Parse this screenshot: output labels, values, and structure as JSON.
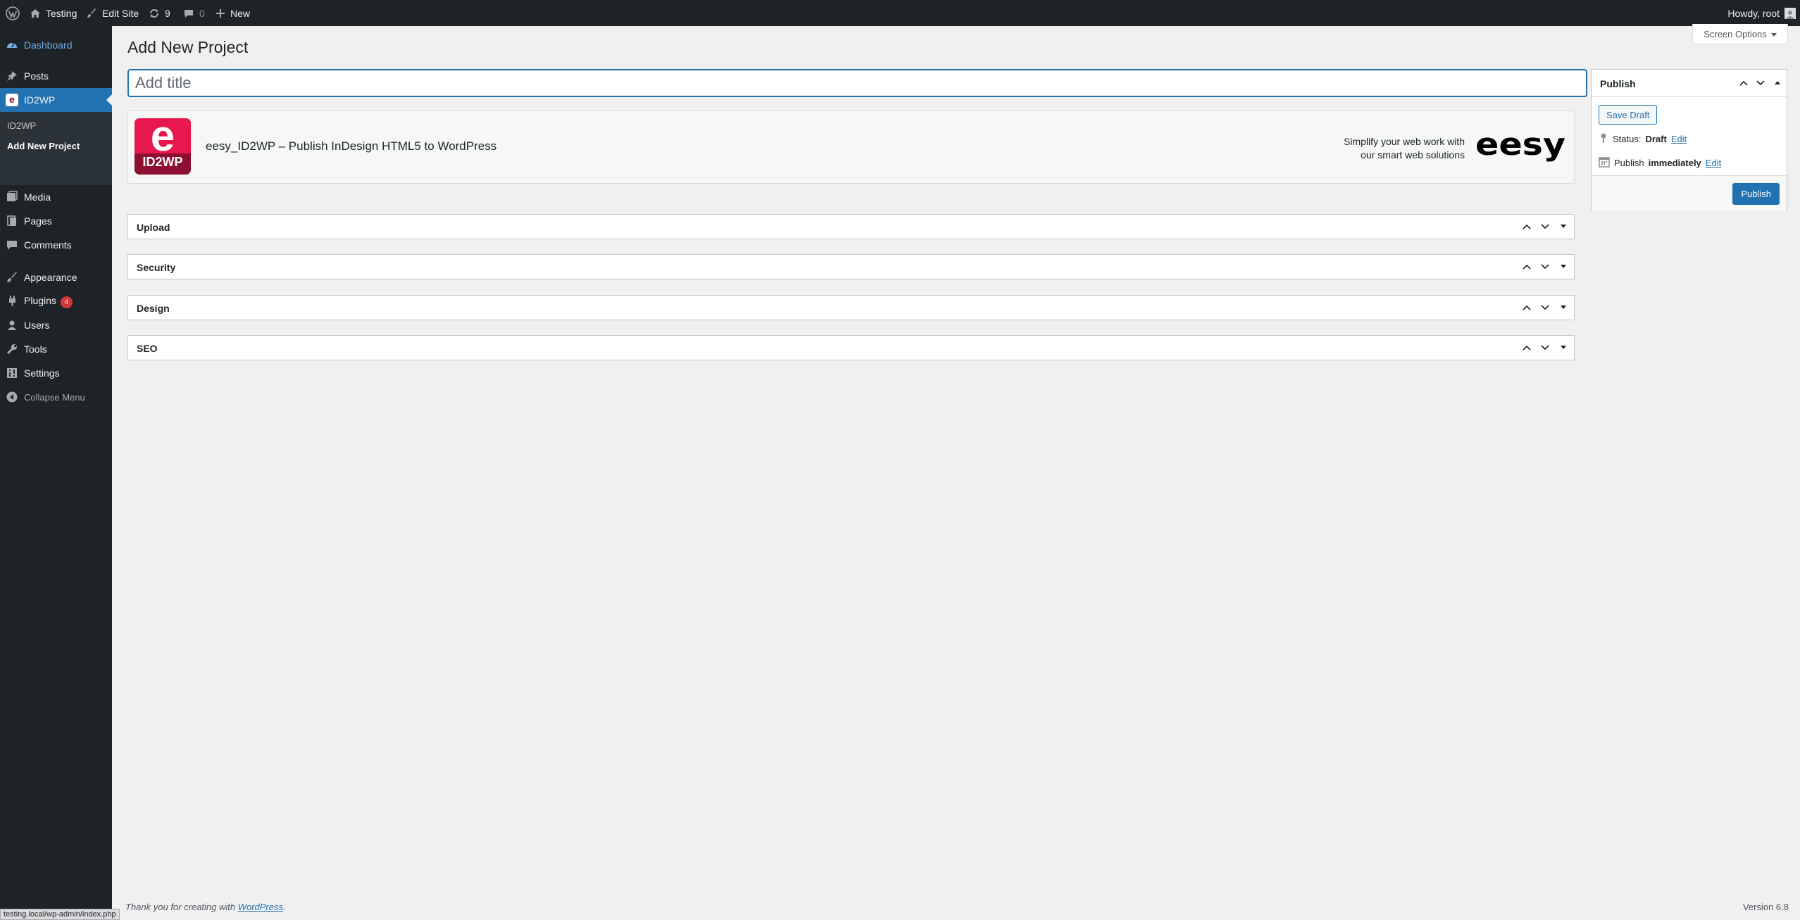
{
  "admin_bar": {
    "site_name": "Testing",
    "edit_site": "Edit Site",
    "updates_count": "9",
    "comments_count": "0",
    "new_label": "New",
    "howdy": "Howdy, root"
  },
  "sidebar": {
    "dashboard": "Dashboard",
    "posts": "Posts",
    "id2wp": "ID2WP",
    "submenu": {
      "id2wp": "ID2WP",
      "add_new": "Add New Project"
    },
    "media": "Media",
    "pages": "Pages",
    "comments": "Comments",
    "appearance": "Appearance",
    "plugins": "Plugins",
    "plugins_badge": "4",
    "users": "Users",
    "tools": "Tools",
    "settings": "Settings",
    "collapse": "Collapse Menu"
  },
  "header": {
    "screen_options": "Screen Options",
    "title": "Add New Project",
    "title_placeholder": "Add title"
  },
  "banner": {
    "logo_text": "ID2WP",
    "title": "eesy_ID2WP – Publish InDesign HTML5 to WordPress",
    "tagline_line1": "Simplify your web work with",
    "tagline_line2": "our smart web solutions",
    "brand": "eesy"
  },
  "metaboxes": {
    "upload": "Upload",
    "security": "Security",
    "design": "Design",
    "seo": "SEO"
  },
  "publish": {
    "title": "Publish",
    "save_draft": "Save Draft",
    "status_label": "Status:",
    "status_value": "Draft",
    "edit": "Edit",
    "publish_label": "Publish",
    "publish_when": "immediately",
    "publish_button": "Publish"
  },
  "footer": {
    "thanks_prefix": "Thank you for creating with",
    "thanks_link": "WordPress",
    "thanks_suffix": ".",
    "version": "Version 6.8"
  },
  "status_bar": {
    "url": "testing.local/wp-admin/index.php"
  },
  "colors": {
    "accent": "#2271b1",
    "admin_bg": "#1d2327",
    "brand": "#e8174d"
  }
}
